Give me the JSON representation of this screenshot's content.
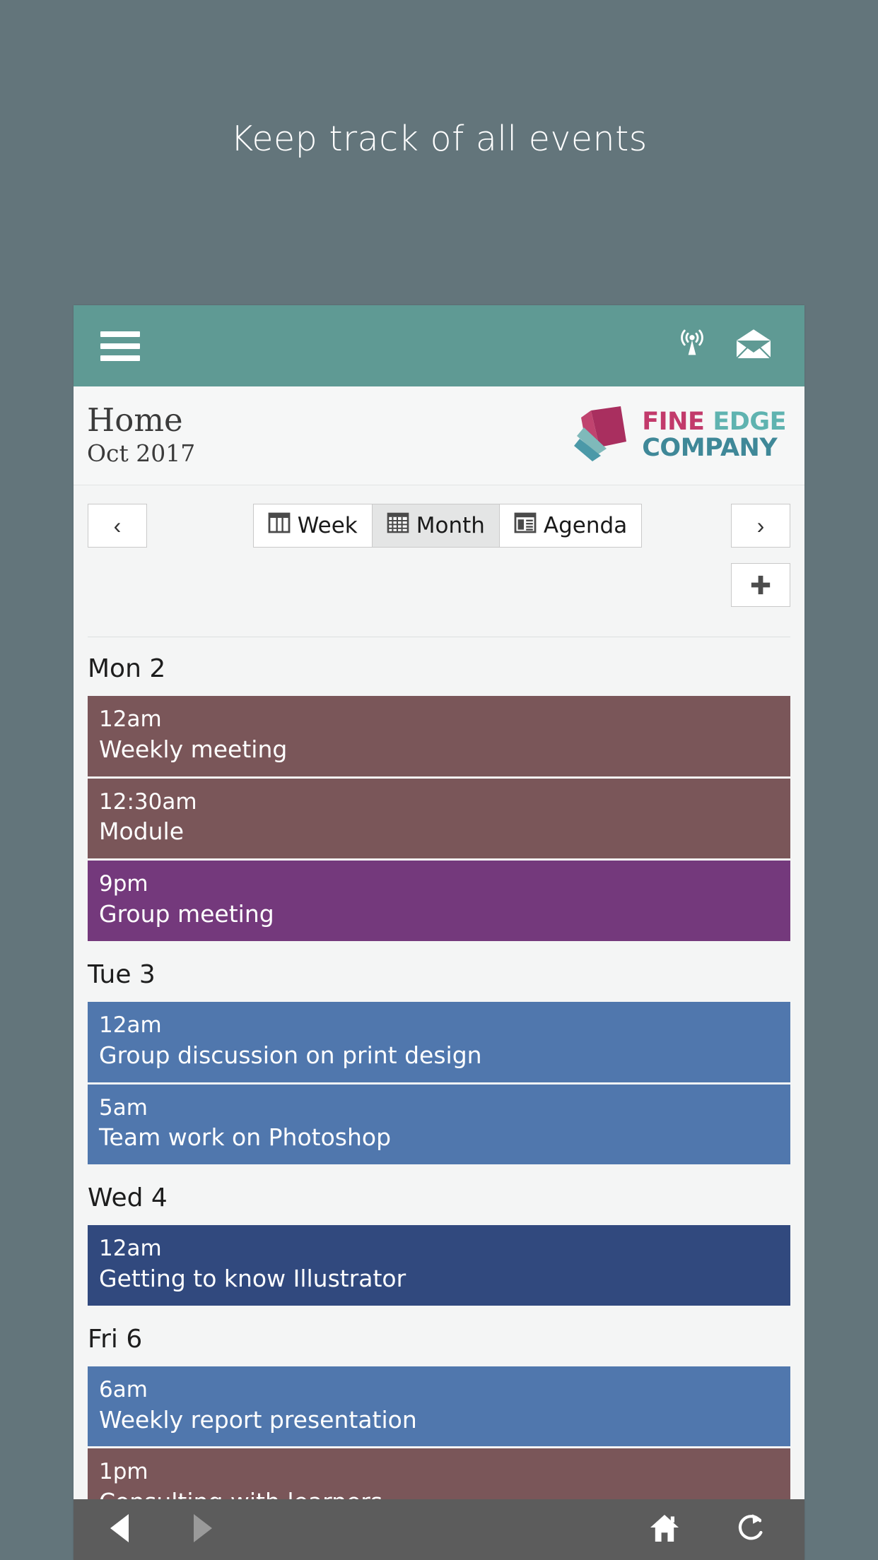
{
  "promo": {
    "headline": "Keep track of all events"
  },
  "colors": {
    "page_background": "#63757b",
    "appbar_teal": "#5f9a94",
    "brand_pink": "#c23a6b",
    "brand_teal": "#5fb3b0",
    "brand_company_teal": "#3f8898",
    "event_brown": "#7a5659",
    "event_purple": "#74397c",
    "event_blue": "#5077ad",
    "event_navy": "#31497e",
    "system_bar": "#5c5c5c"
  },
  "appbar": {
    "menu_icon": "hamburger-menu-icon",
    "actions": [
      {
        "icon": "broadcast-antenna-icon",
        "name": "broadcast-button"
      },
      {
        "icon": "envelope-mail-icon",
        "name": "mail-button"
      }
    ]
  },
  "header": {
    "title": "Home",
    "subtitle": "Oct 2017",
    "logo": {
      "icon": "stacked-books-logo-icon",
      "word1": "FINE",
      "word2": "EDGE",
      "word3": "COMPANY"
    }
  },
  "toolbar": {
    "prev_label": "‹",
    "next_label": "›",
    "add_label": "+",
    "views": [
      {
        "label": "Week",
        "icon": "week-view-icon",
        "active": false
      },
      {
        "label": "Month",
        "icon": "month-grid-icon",
        "active": true
      },
      {
        "label": "Agenda",
        "icon": "agenda-list-icon",
        "active": false
      }
    ]
  },
  "agenda": {
    "days": [
      {
        "label": "Mon 2",
        "events": [
          {
            "time": "12am",
            "title": "Weekly meeting",
            "color": "#7a5659"
          },
          {
            "time": "12:30am",
            "title": "Module",
            "color": "#7a5659"
          },
          {
            "time": "9pm",
            "title": "Group meeting",
            "color": "#74397c"
          }
        ]
      },
      {
        "label": "Tue 3",
        "events": [
          {
            "time": "12am",
            "title": "Group discussion on print design",
            "color": "#5077ad"
          },
          {
            "time": "5am",
            "title": "Team work on Photoshop",
            "color": "#5077ad"
          }
        ]
      },
      {
        "label": "Wed 4",
        "events": [
          {
            "time": "12am",
            "title": "Getting to know Illustrator",
            "color": "#31497e"
          }
        ]
      },
      {
        "label": "Fri 6",
        "events": [
          {
            "time": "6am",
            "title": "Weekly report presentation",
            "color": "#5077ad"
          },
          {
            "time": "1pm",
            "title": "Consulting with learners",
            "color": "#7a5659"
          }
        ]
      }
    ]
  },
  "systembar": {
    "buttons": [
      {
        "icon": "back-arrow-icon",
        "name": "back-button",
        "enabled": true
      },
      {
        "icon": "forward-arrow-icon",
        "name": "forward-button",
        "enabled": false
      },
      {
        "icon": "home-icon",
        "name": "home-button",
        "enabled": true
      },
      {
        "icon": "refresh-icon",
        "name": "refresh-button",
        "enabled": true
      }
    ]
  }
}
